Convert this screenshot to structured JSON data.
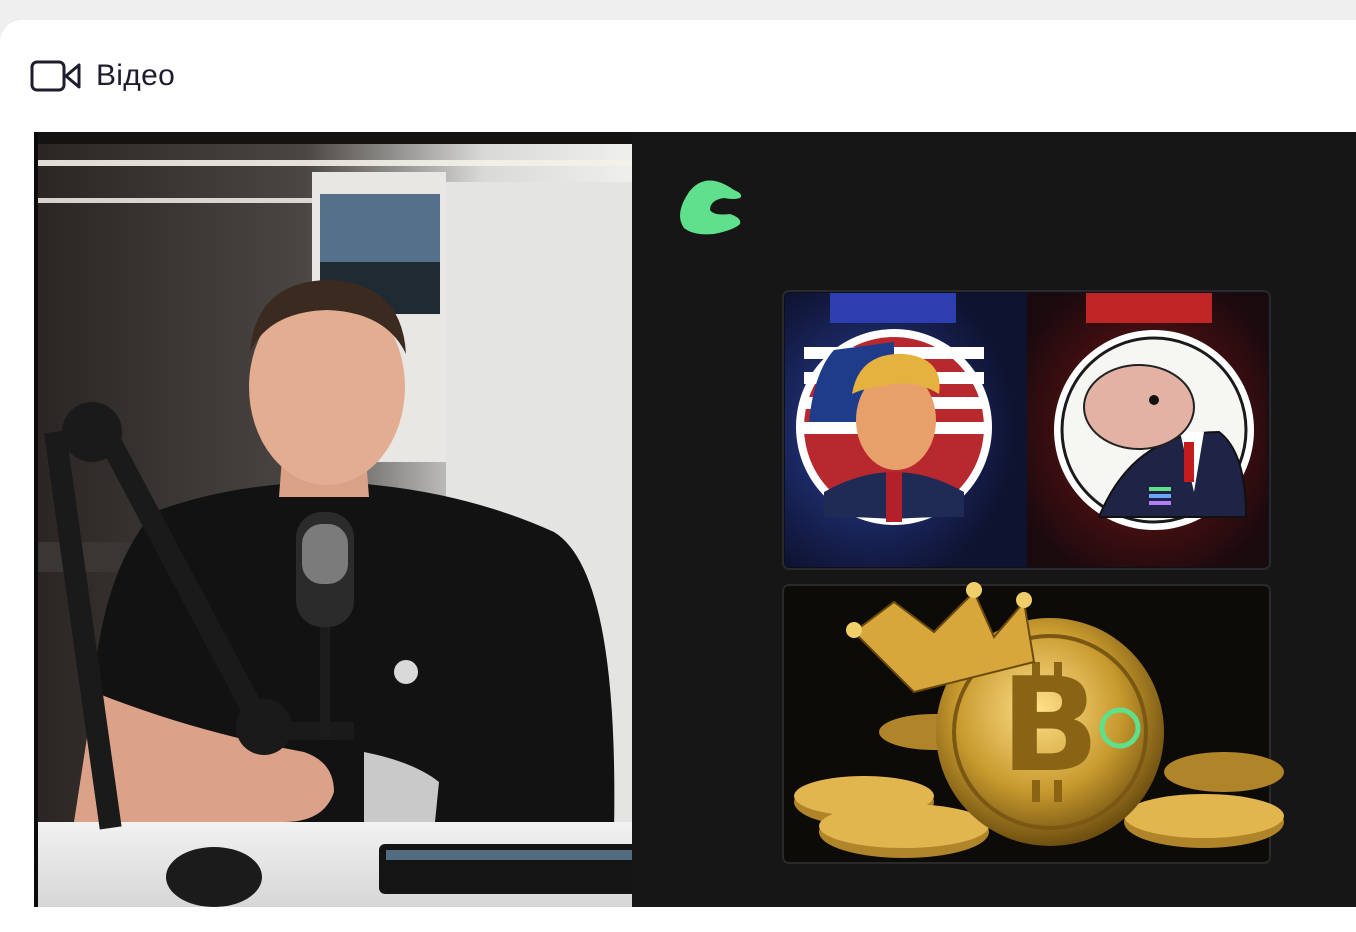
{
  "section": {
    "title": "Відео",
    "icon": "video-camera-icon"
  },
  "video": {
    "brand_color": "#5fe08c",
    "left_panel": "presenter-at-desk",
    "right_panel_cards": [
      "two-coin-characters",
      "bitcoin-with-crown"
    ]
  }
}
